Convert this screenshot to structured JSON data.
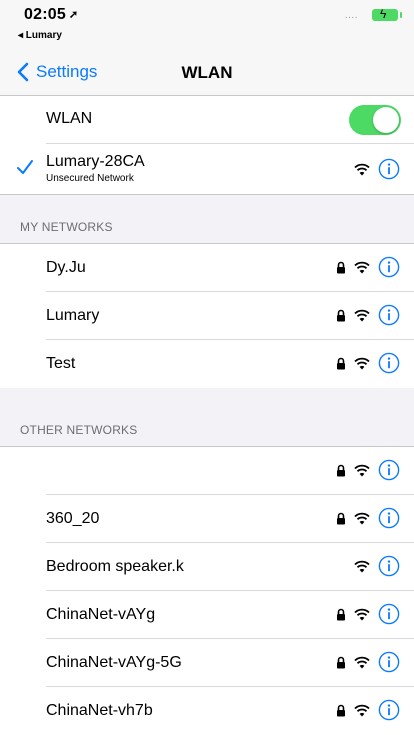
{
  "status_bar": {
    "time": "02:05",
    "back_app": "◂ Lumary",
    "signal": "....",
    "battery_color": "#4cd964"
  },
  "nav": {
    "back_label": "Settings",
    "title": "WLAN"
  },
  "wlan_toggle": {
    "label": "WLAN",
    "on": true
  },
  "connected": {
    "name": "Lumary-28CA",
    "subtitle": "Unsecured Network"
  },
  "my_networks": {
    "header": "MY NETWORKS",
    "items": [
      {
        "name": "Dy.Ju",
        "locked": true
      },
      {
        "name": "Lumary",
        "locked": true
      },
      {
        "name": "Test",
        "locked": true
      }
    ]
  },
  "other_networks": {
    "header": "OTHER NETWORKS",
    "items": [
      {
        "name": "",
        "locked": true
      },
      {
        "name": "360_20",
        "locked": true
      },
      {
        "name": "Bedroom speaker.k",
        "locked": false
      },
      {
        "name": "ChinaNet-vAYg",
        "locked": true
      },
      {
        "name": "ChinaNet-vAYg-5G",
        "locked": true
      },
      {
        "name": "ChinaNet-vh7b",
        "locked": true
      }
    ]
  },
  "colors": {
    "accent": "#0a7aff",
    "toggle_on": "#4cd964",
    "background": "#f2f2f7"
  },
  "icons": [
    "location-arrow-icon",
    "battery-icon",
    "chevron-left-icon",
    "checkmark-icon",
    "lock-icon",
    "wifi-icon",
    "info-icon"
  ]
}
